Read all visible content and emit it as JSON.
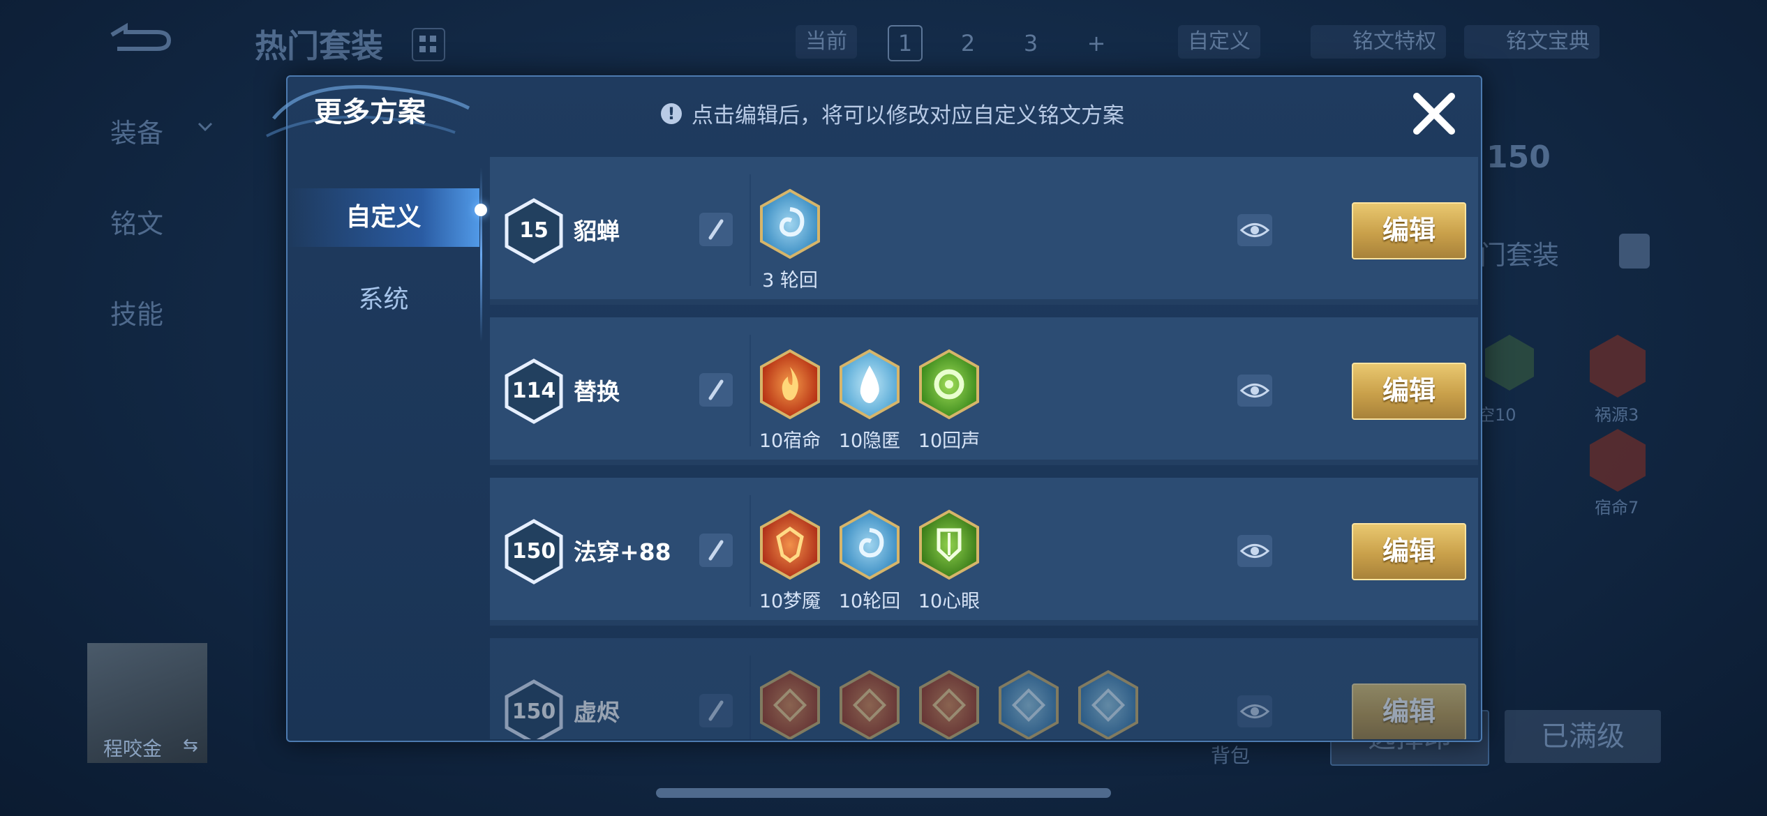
{
  "background": {
    "title": "热门套装",
    "side_nav": [
      "装备",
      "铭文",
      "技能"
    ],
    "current_label": "当前",
    "pages": [
      "1",
      "2",
      "3",
      "+"
    ],
    "custom_label": "自定义",
    "privilege_label": "铭文特权",
    "codex_label": "铭文宝典",
    "level_badge": "150",
    "hot_set_label": "门套装",
    "rune_labels": [
      "空10",
      "祸源3",
      "宿命7"
    ],
    "hero_name": "程咬金",
    "bag_label": "背包",
    "select_btn": "选择印",
    "maxed_btn": "已满级"
  },
  "modal": {
    "title": "更多方案",
    "notice": "点击编辑后，将可以修改对应自定义铭文方案",
    "tabs": [
      {
        "label": "自定义",
        "active": true
      },
      {
        "label": "系统",
        "active": false
      }
    ],
    "edit_label": "编辑",
    "plans": [
      {
        "level": "15",
        "name": "貂蝉",
        "runes": [
          {
            "label": "3 轮回",
            "icon": "vortex-blue"
          }
        ]
      },
      {
        "level": "114",
        "name": "替换",
        "runes": [
          {
            "label": "10宿命",
            "icon": "flame-red"
          },
          {
            "label": "10隐匿",
            "icon": "drop-blue"
          },
          {
            "label": "10回声",
            "icon": "ring-green"
          }
        ]
      },
      {
        "level": "150",
        "name": "法穿+88",
        "runes": [
          {
            "label": "10梦魇",
            "icon": "crest-red"
          },
          {
            "label": "10轮回",
            "icon": "vortex-blue"
          },
          {
            "label": "10心眼",
            "icon": "shield-green"
          }
        ]
      },
      {
        "level": "150",
        "name": "虚烬",
        "runes": [
          {
            "label": "",
            "icon": "rune-red"
          },
          {
            "label": "",
            "icon": "rune-red"
          },
          {
            "label": "",
            "icon": "rune-red"
          },
          {
            "label": "",
            "icon": "rune-blue"
          },
          {
            "label": "",
            "icon": "rune-blue"
          }
        ]
      }
    ]
  },
  "colors": {
    "accent_gold": "#d9b45c",
    "panel": "#2c4c73",
    "red_rune": "#c8411e",
    "blue_rune": "#4fa3d6",
    "green_rune": "#4f9a23"
  }
}
